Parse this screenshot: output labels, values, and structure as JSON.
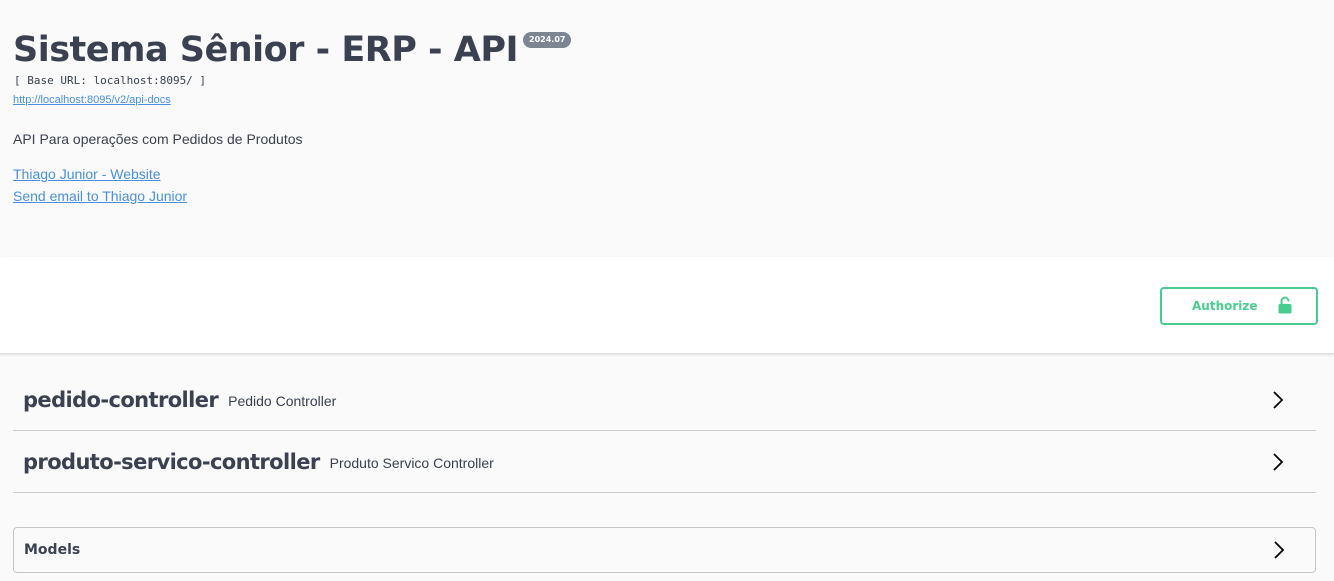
{
  "info": {
    "title": "Sistema Sênior - ERP - API",
    "version": "2024.07",
    "base_url": "[ Base URL: localhost:8095/ ]",
    "docs_link": "http://localhost:8095/v2/api-docs",
    "description": "API Para operações com Pedidos de Produtos",
    "contact_website": "Thiago Junior - Website",
    "contact_email": "Send email to Thiago Junior"
  },
  "auth": {
    "authorize_label": "Authorize",
    "icon": "lock-icon",
    "color": "#49cc90"
  },
  "tags": [
    {
      "name": "pedido-controller",
      "description": "Pedido Controller",
      "icon": "chevron-right-icon"
    },
    {
      "name": "produto-servico-controller",
      "description": "Produto Servico Controller",
      "icon": "chevron-right-icon"
    }
  ],
  "models": {
    "label": "Models",
    "icon": "chevron-right-icon"
  },
  "colors": {
    "text": "#3b4151",
    "link": "#4990e2",
    "badge": "#7d8492"
  }
}
